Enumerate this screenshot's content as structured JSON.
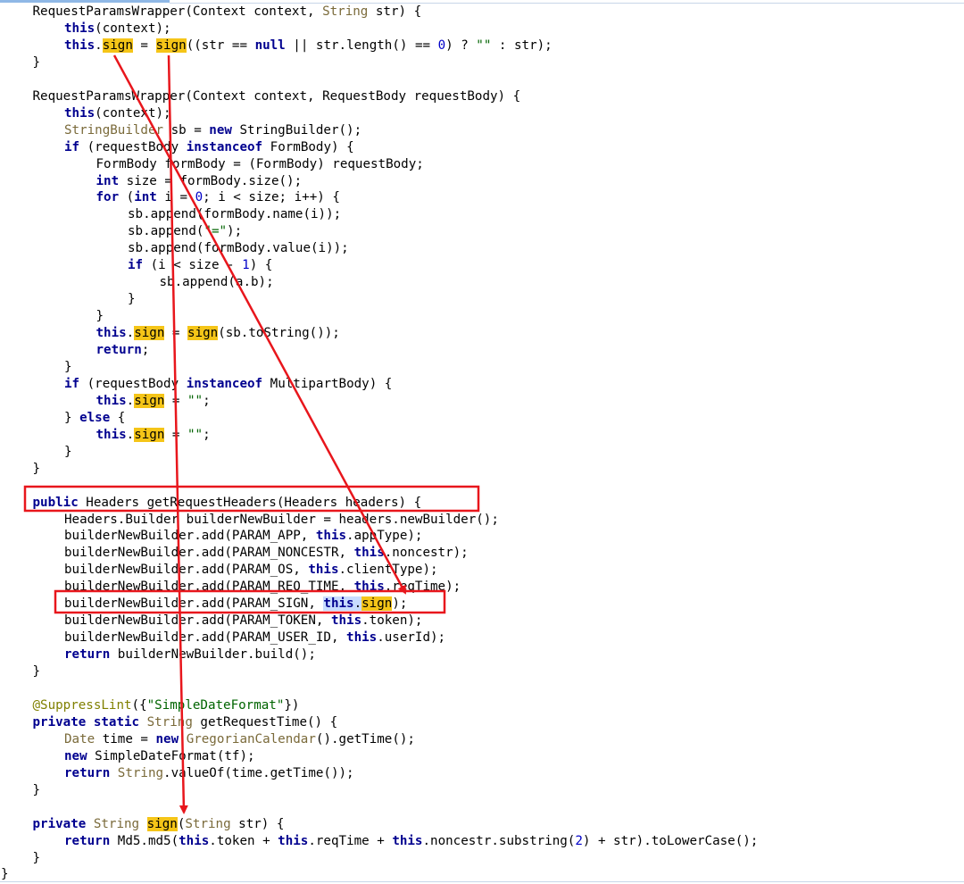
{
  "colors": {
    "annotation_red": "#e8161c",
    "occurrence_highlight": "#f5c518",
    "selection_highlight": "#c8dcff",
    "keyword": "#00008f",
    "string": "#006400"
  },
  "code_lines": [
    {
      "indent": 1,
      "tokens": [
        {
          "t": "RequestParamsWrapper(Context context, "
        },
        {
          "t": "String",
          "c": "ty"
        },
        {
          "t": " str) {"
        }
      ]
    },
    {
      "indent": 2,
      "tokens": [
        {
          "t": "this",
          "c": "kw"
        },
        {
          "t": "(context);"
        }
      ]
    },
    {
      "indent": 2,
      "tokens": [
        {
          "t": "this",
          "c": "kw"
        },
        {
          "t": "."
        },
        {
          "t": "sign",
          "c": "hl"
        },
        {
          "t": " = "
        },
        {
          "t": "sign",
          "c": "hl"
        },
        {
          "t": "((str == "
        },
        {
          "t": "null",
          "c": "kw"
        },
        {
          "t": " || str.length() == "
        },
        {
          "t": "0",
          "c": "num"
        },
        {
          "t": ") ? "
        },
        {
          "t": "\"\"",
          "c": "str"
        },
        {
          "t": " : str);"
        }
      ]
    },
    {
      "indent": 1,
      "tokens": [
        {
          "t": "}"
        }
      ]
    },
    {
      "indent": 0,
      "tokens": []
    },
    {
      "indent": 1,
      "tokens": [
        {
          "t": "RequestParamsWrapper(Context context, RequestBody requestBody) {"
        }
      ]
    },
    {
      "indent": 2,
      "tokens": [
        {
          "t": "this",
          "c": "kw"
        },
        {
          "t": "(context);"
        }
      ]
    },
    {
      "indent": 2,
      "tokens": [
        {
          "t": "StringBuilder",
          "c": "ty"
        },
        {
          "t": " sb = "
        },
        {
          "t": "new",
          "c": "kw"
        },
        {
          "t": " StringBuilder();"
        }
      ]
    },
    {
      "indent": 2,
      "tokens": [
        {
          "t": "if",
          "c": "kw"
        },
        {
          "t": " (requestBody "
        },
        {
          "t": "instanceof",
          "c": "kw"
        },
        {
          "t": " FormBody) {"
        }
      ]
    },
    {
      "indent": 3,
      "tokens": [
        {
          "t": "FormBody formBody = (FormBody) requestBody;"
        }
      ]
    },
    {
      "indent": 3,
      "tokens": [
        {
          "t": "int",
          "c": "kw"
        },
        {
          "t": " size = formBody.size();"
        }
      ]
    },
    {
      "indent": 3,
      "tokens": [
        {
          "t": "for",
          "c": "kw"
        },
        {
          "t": " ("
        },
        {
          "t": "int",
          "c": "kw"
        },
        {
          "t": " i = "
        },
        {
          "t": "0",
          "c": "num"
        },
        {
          "t": "; i < size; i++) {"
        }
      ]
    },
    {
      "indent": 4,
      "tokens": [
        {
          "t": "sb.append(formBody.name(i));"
        }
      ]
    },
    {
      "indent": 4,
      "tokens": [
        {
          "t": "sb.append("
        },
        {
          "t": "\"=\"",
          "c": "str"
        },
        {
          "t": ");"
        }
      ]
    },
    {
      "indent": 4,
      "tokens": [
        {
          "t": "sb.append(formBody.value(i));"
        }
      ]
    },
    {
      "indent": 4,
      "tokens": [
        {
          "t": "if",
          "c": "kw"
        },
        {
          "t": " (i < size - "
        },
        {
          "t": "1",
          "c": "num"
        },
        {
          "t": ") {"
        }
      ]
    },
    {
      "indent": 5,
      "tokens": [
        {
          "t": "sb.append(a.b);"
        }
      ]
    },
    {
      "indent": 4,
      "tokens": [
        {
          "t": "}"
        }
      ]
    },
    {
      "indent": 3,
      "tokens": [
        {
          "t": "}"
        }
      ]
    },
    {
      "indent": 3,
      "tokens": [
        {
          "t": "this",
          "c": "kw"
        },
        {
          "t": "."
        },
        {
          "t": "sign",
          "c": "hl"
        },
        {
          "t": " = "
        },
        {
          "t": "sign",
          "c": "hl"
        },
        {
          "t": "(sb.toString());"
        }
      ]
    },
    {
      "indent": 3,
      "tokens": [
        {
          "t": "return",
          "c": "kw"
        },
        {
          "t": ";"
        }
      ]
    },
    {
      "indent": 2,
      "tokens": [
        {
          "t": "}"
        }
      ]
    },
    {
      "indent": 2,
      "tokens": [
        {
          "t": "if",
          "c": "kw"
        },
        {
          "t": " (requestBody "
        },
        {
          "t": "instanceof",
          "c": "kw"
        },
        {
          "t": " MultipartBody) {"
        }
      ]
    },
    {
      "indent": 3,
      "tokens": [
        {
          "t": "this",
          "c": "kw"
        },
        {
          "t": "."
        },
        {
          "t": "sign",
          "c": "hl"
        },
        {
          "t": " = "
        },
        {
          "t": "\"\"",
          "c": "str"
        },
        {
          "t": ";"
        }
      ]
    },
    {
      "indent": 2,
      "tokens": [
        {
          "t": "} "
        },
        {
          "t": "else",
          "c": "kw"
        },
        {
          "t": " {"
        }
      ]
    },
    {
      "indent": 3,
      "tokens": [
        {
          "t": "this",
          "c": "kw"
        },
        {
          "t": "."
        },
        {
          "t": "sign",
          "c": "hl"
        },
        {
          "t": " = "
        },
        {
          "t": "\"\"",
          "c": "str"
        },
        {
          "t": ";"
        }
      ]
    },
    {
      "indent": 2,
      "tokens": [
        {
          "t": "}"
        }
      ]
    },
    {
      "indent": 1,
      "tokens": [
        {
          "t": "}"
        }
      ]
    },
    {
      "indent": 0,
      "tokens": []
    },
    {
      "indent": 1,
      "tokens": [
        {
          "t": "public",
          "c": "kw"
        },
        {
          "t": " Headers getRequestHeaders(Headers headers) {"
        }
      ]
    },
    {
      "indent": 2,
      "tokens": [
        {
          "t": "Headers.Builder builderNewBuilder = headers.newBuilder();"
        }
      ]
    },
    {
      "indent": 2,
      "tokens": [
        {
          "t": "builderNewBuilder.add(PARAM_APP, "
        },
        {
          "t": "this",
          "c": "kw"
        },
        {
          "t": ".appType);"
        }
      ]
    },
    {
      "indent": 2,
      "tokens": [
        {
          "t": "builderNewBuilder.add(PARAM_NONCESTR, "
        },
        {
          "t": "this",
          "c": "kw"
        },
        {
          "t": ".noncestr);"
        }
      ]
    },
    {
      "indent": 2,
      "tokens": [
        {
          "t": "builderNewBuilder.add(PARAM_OS, "
        },
        {
          "t": "this",
          "c": "kw"
        },
        {
          "t": ".clientType);"
        }
      ]
    },
    {
      "indent": 2,
      "tokens": [
        {
          "t": "builderNewBuilder.add(PARAM_REQ_TIME, "
        },
        {
          "t": "this",
          "c": "kw"
        },
        {
          "t": ".reqTime);"
        }
      ]
    },
    {
      "indent": 2,
      "tokens": [
        {
          "t": "builderNewBuilder.add(PARAM_SIGN, "
        },
        {
          "t": "this",
          "c": "kw sel"
        },
        {
          "t": ".",
          "c": "sel"
        },
        {
          "t": "sign",
          "c": "hl"
        },
        {
          "t": ");"
        }
      ]
    },
    {
      "indent": 2,
      "tokens": [
        {
          "t": "builderNewBuilder.add(PARAM_TOKEN, "
        },
        {
          "t": "this",
          "c": "kw"
        },
        {
          "t": ".token);"
        }
      ]
    },
    {
      "indent": 2,
      "tokens": [
        {
          "t": "builderNewBuilder.add(PARAM_USER_ID, "
        },
        {
          "t": "this",
          "c": "kw"
        },
        {
          "t": ".userId);"
        }
      ]
    },
    {
      "indent": 2,
      "tokens": [
        {
          "t": "return",
          "c": "kw"
        },
        {
          "t": " builderNewBuilder.build();"
        }
      ]
    },
    {
      "indent": 1,
      "tokens": [
        {
          "t": "}"
        }
      ]
    },
    {
      "indent": 0,
      "tokens": []
    },
    {
      "indent": 1,
      "tokens": [
        {
          "t": "@SuppressLint",
          "c": "ann"
        },
        {
          "t": "({"
        },
        {
          "t": "\"SimpleDateFormat\"",
          "c": "str"
        },
        {
          "t": "})"
        }
      ]
    },
    {
      "indent": 1,
      "tokens": [
        {
          "t": "private",
          "c": "kw"
        },
        {
          "t": " "
        },
        {
          "t": "static",
          "c": "kw"
        },
        {
          "t": " "
        },
        {
          "t": "String",
          "c": "ty"
        },
        {
          "t": " getRequestTime() {"
        }
      ]
    },
    {
      "indent": 2,
      "tokens": [
        {
          "t": "Date",
          "c": "ty"
        },
        {
          "t": " time = "
        },
        {
          "t": "new",
          "c": "kw"
        },
        {
          "t": " "
        },
        {
          "t": "GregorianCalendar",
          "c": "ty"
        },
        {
          "t": "().getTime();"
        }
      ]
    },
    {
      "indent": 2,
      "tokens": [
        {
          "t": "new",
          "c": "kw"
        },
        {
          "t": " SimpleDateFormat(tf);"
        }
      ]
    },
    {
      "indent": 2,
      "tokens": [
        {
          "t": "return",
          "c": "kw"
        },
        {
          "t": " "
        },
        {
          "t": "String",
          "c": "ty"
        },
        {
          "t": ".valueOf(time.getTime());"
        }
      ]
    },
    {
      "indent": 1,
      "tokens": [
        {
          "t": "}"
        }
      ]
    },
    {
      "indent": 0,
      "tokens": []
    },
    {
      "indent": 1,
      "tokens": [
        {
          "t": "private",
          "c": "kw"
        },
        {
          "t": " "
        },
        {
          "t": "String",
          "c": "ty"
        },
        {
          "t": " "
        },
        {
          "t": "sign",
          "c": "hl"
        },
        {
          "t": "("
        },
        {
          "t": "String",
          "c": "ty"
        },
        {
          "t": " str) {"
        }
      ]
    },
    {
      "indent": 2,
      "tokens": [
        {
          "t": "return",
          "c": "kw"
        },
        {
          "t": " Md5.md5("
        },
        {
          "t": "this",
          "c": "kw"
        },
        {
          "t": ".token + "
        },
        {
          "t": "this",
          "c": "kw"
        },
        {
          "t": ".reqTime + "
        },
        {
          "t": "this",
          "c": "kw"
        },
        {
          "t": ".noncestr.substring("
        },
        {
          "t": "2",
          "c": "num"
        },
        {
          "t": ") + str).toLowerCase();"
        }
      ]
    },
    {
      "indent": 1,
      "tokens": [
        {
          "t": "}"
        }
      ]
    },
    {
      "indent": 0,
      "tokens": [
        {
          "t": "}"
        }
      ]
    }
  ],
  "annotations": {
    "boxes": [
      {
        "label": "box-getRequestHeaders",
        "line": 29
      },
      {
        "label": "box-param-sign",
        "line": 35
      }
    ],
    "arrows": [
      {
        "label": "arrow-field-to-param-sign",
        "from_line": 2,
        "to_line": 35
      },
      {
        "label": "arrow-call-to-sign-method",
        "from_line": 2,
        "to_line": 48
      }
    ]
  }
}
